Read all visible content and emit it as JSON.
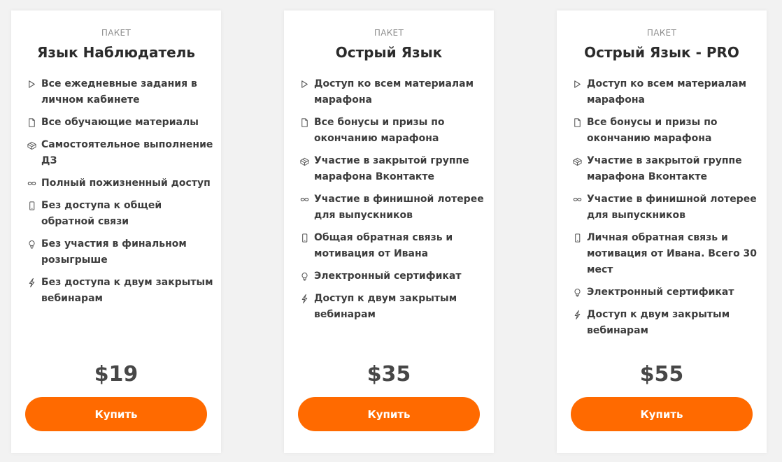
{
  "colors": {
    "accent": "#ff6a00",
    "card_background": "#ffffff",
    "page_background": "#f2f2f2",
    "text": "#3d3d3d",
    "muted": "#8e8e8e"
  },
  "packages": [
    {
      "label": "ПАКЕТ",
      "title": "Язык Наблюдатель",
      "features": [
        {
          "icon": "play-icon",
          "text": "Все ежедневные задания в личном кабинете"
        },
        {
          "icon": "document-icon",
          "text": "Все обучающие материалы"
        },
        {
          "icon": "box-icon",
          "text": "Самостоятельное выполнение ДЗ"
        },
        {
          "icon": "infinity-icon",
          "text": "Полный пожизненный доступ"
        },
        {
          "icon": "phone-icon",
          "text": "Без доступа к общей обратной связи"
        },
        {
          "icon": "bulb-icon",
          "text": "Без участия в финальном розыгрыше"
        },
        {
          "icon": "lightning-icon",
          "text": "Без доступа к двум закрытым вебинарам"
        }
      ],
      "price": "$19",
      "button_label": "Купить"
    },
    {
      "label": "ПАКЕТ",
      "title": "Острый Язык",
      "features": [
        {
          "icon": "play-icon",
          "text": "Доступ ко всем материалам марафона"
        },
        {
          "icon": "document-icon",
          "text": "Все бонусы и призы по окончанию марафона"
        },
        {
          "icon": "box-icon",
          "text": "Участие в закрытой группе марафона Вконтакте"
        },
        {
          "icon": "infinity-icon",
          "text": "Участие в финишной лотерее для выпускников"
        },
        {
          "icon": "phone-icon",
          "text": "Общая обратная связь и мотивация от Ивана"
        },
        {
          "icon": "bulb-icon",
          "text": "Электронный сертификат"
        },
        {
          "icon": "lightning-icon",
          "text": "Доступ к двум закрытым вебинарам"
        }
      ],
      "price": "$35",
      "button_label": "Купить"
    },
    {
      "label": "ПАКЕТ",
      "title": "Острый Язык - PRO",
      "features": [
        {
          "icon": "play-icon",
          "text": "Доступ ко всем материалам марафона"
        },
        {
          "icon": "document-icon",
          "text": "Все бонусы и призы по окончанию марафона"
        },
        {
          "icon": "box-icon",
          "text": "Участие в закрытой группе марафона Вконтакте"
        },
        {
          "icon": "infinity-icon",
          "text": "Участие в финишной лотерее для выпускников"
        },
        {
          "icon": "phone-icon",
          "text": "Личная обратная связь и мотивация от Ивана. Всего 30 мест"
        },
        {
          "icon": "bulb-icon",
          "text": "Электронный сертификат"
        },
        {
          "icon": "lightning-icon",
          "text": "Доступ к двум закрытым вебинарам"
        }
      ],
      "price": "$55",
      "button_label": "Купить"
    }
  ]
}
